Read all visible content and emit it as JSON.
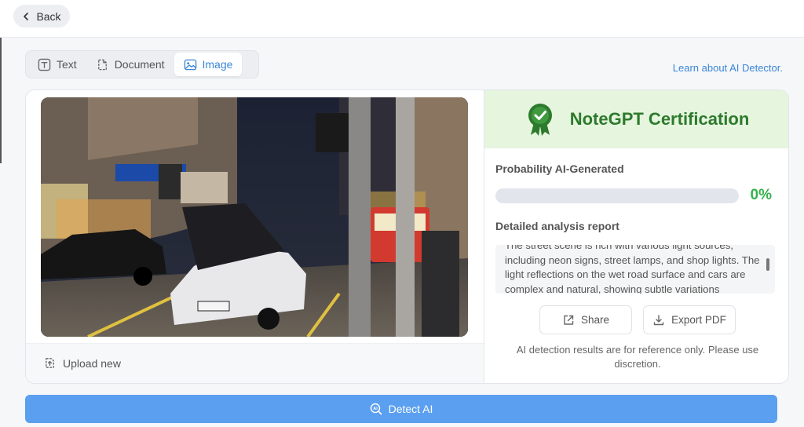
{
  "header": {
    "back_label": "Back"
  },
  "tabs": [
    {
      "label": "Text",
      "icon": "text-icon",
      "active": false
    },
    {
      "label": "Document",
      "icon": "document-icon",
      "active": false
    },
    {
      "label": "Image",
      "icon": "image-icon",
      "active": true
    }
  ],
  "learn_link": "Learn about AI Detector.",
  "upload": {
    "label": "Upload new",
    "icon": "upload-icon"
  },
  "certification": {
    "title": "NoteGPT Certification",
    "icon": "ribbon-check-icon",
    "color": "#2d7a2d",
    "background": "#e6f5de"
  },
  "probability": {
    "label": "Probability AI-Generated",
    "value": "0%",
    "fraction": 0.0,
    "color": "#37b24d"
  },
  "report": {
    "label": "Detailed analysis report",
    "text": "The street scene is rich with various light sources, including neon signs, street lamps, and shop lights. The light reflections on the wet road surface and cars are complex and natural, showing subtle variations"
  },
  "actions": {
    "share_label": "Share",
    "export_label": "Export PDF"
  },
  "disclaimer": "AI detection results are for reference only. Please use discretion.",
  "detect_button": {
    "label": "Detect AI",
    "color": "#5b9ff0"
  },
  "accent_color": "#3a86d8"
}
